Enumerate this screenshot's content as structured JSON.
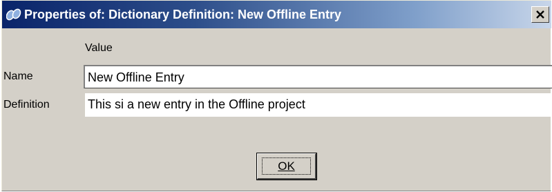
{
  "window": {
    "title": "Properties of: Dictionary Definition: New Offline Entry",
    "icon": "app-logo-icon",
    "close_icon": "close-icon"
  },
  "grid": {
    "column_header": "Value",
    "rows": [
      {
        "label": "Name",
        "value": "New Offline Entry"
      },
      {
        "label": "Definition",
        "value": "This si a new entry in the Offline project"
      }
    ]
  },
  "buttons": {
    "ok_label": "OK"
  }
}
